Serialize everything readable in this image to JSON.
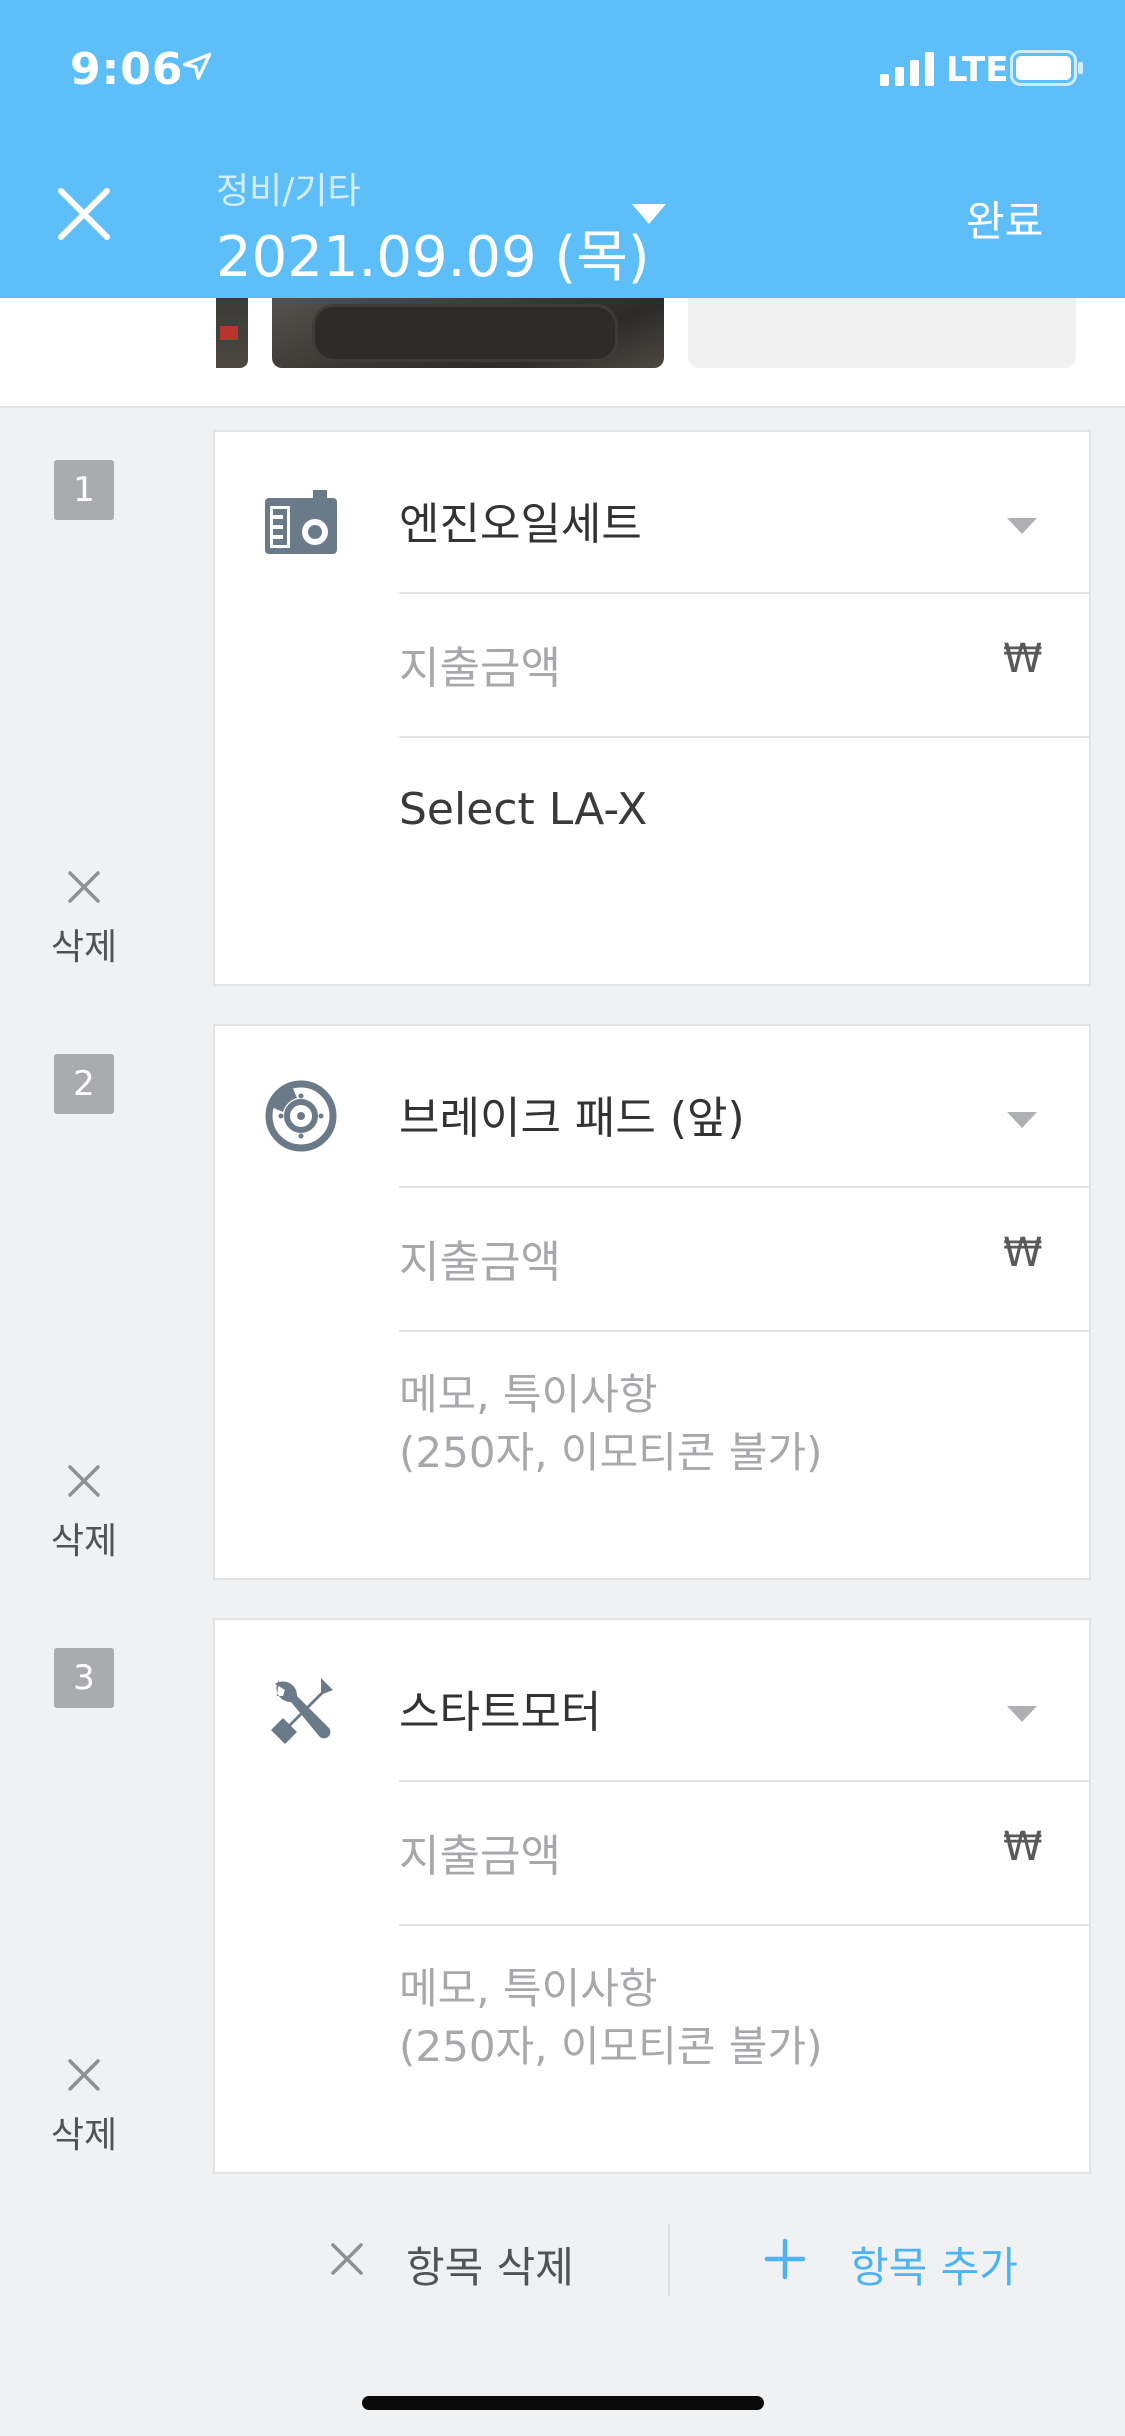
{
  "status_bar": {
    "time": "9:06",
    "network": "LTE",
    "icons": [
      "location-arrow-icon",
      "signal-icon",
      "battery-icon"
    ]
  },
  "header": {
    "close_icon": "close-icon",
    "category": "정비/기타",
    "date": "2021.09.09 (목)",
    "dropdown_icon": "caret-down-icon",
    "done_label": "완료",
    "background_color": "#5ebff8"
  },
  "photos": {
    "count": 3,
    "icons": [
      "photo-thumbnail",
      "brake-pad-photo",
      "empty-photo-slot"
    ]
  },
  "items": [
    {
      "number": "1",
      "icon": "oil-can-icon",
      "category": "엔진오일세트",
      "amount_placeholder": "지출금액",
      "currency": "₩",
      "memo": "Select LA-X",
      "delete_label": "삭제"
    },
    {
      "number": "2",
      "icon": "brake-disc-icon",
      "category": "브레이크 패드 (앞)",
      "amount_placeholder": "지출금액",
      "currency": "₩",
      "memo_placeholder": "메모, 특이사항\n(250자, 이모티콘 불가)",
      "delete_label": "삭제"
    },
    {
      "number": "3",
      "icon": "wrench-screwdriver-icon",
      "category": "스타트모터",
      "amount_placeholder": "지출금액",
      "currency": "₩",
      "memo_placeholder": "메모, 특이사항\n(250자, 이모티콘 불가)",
      "delete_label": "삭제"
    }
  ],
  "bottom_actions": {
    "delete_label": "항목 삭제",
    "add_label": "항목 추가",
    "add_color": "#4db3f2"
  }
}
